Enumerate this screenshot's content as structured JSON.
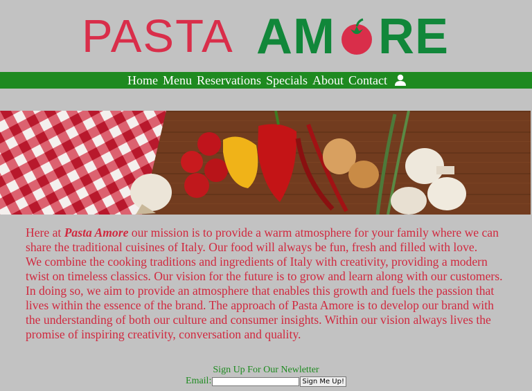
{
  "logo": {
    "word1": "PASTA",
    "word2_start": "AM",
    "word2_end": "RE"
  },
  "nav": {
    "items": [
      "Home",
      "Menu",
      "Reservations",
      "Specials",
      "About",
      "Contact"
    ],
    "account_icon": "user-icon"
  },
  "hero": {
    "icon": "vegetables-banner"
  },
  "content": {
    "p1_prefix": "Here at ",
    "p1_brand": "Pasta Amore",
    "p1_rest": " our mission is to provide a warm atmosphere for your family where we can share the traditional cuisines of Italy. Our food will always be fun, fresh and filled with love.",
    "p2": "We combine the cooking traditions and ingredients of Italy with creativity, providing a modern twist on timeless classics. Our vision for the future is to grow and learn along with our customers. In doing so, we aim to provide an atmosphere that enables this growth and fuels the passion that lives within the essence of the brand. The approach of Pasta Amore is to develop our brand with the understanding of both our culture and consumer insights. Within our vision always lives the promise of inspiring creativity, conversation and quality."
  },
  "newsletter": {
    "title": "Sign Up For Our Newletter",
    "email_label": "Email:",
    "email_value": "",
    "button_label": "Sign Me Up!"
  },
  "colors": {
    "background": "#c2c2c2",
    "nav_green": "#1e8a20",
    "brand_red": "#d92e4a",
    "brand_green": "#11873a",
    "text_red": "#d0293f"
  }
}
